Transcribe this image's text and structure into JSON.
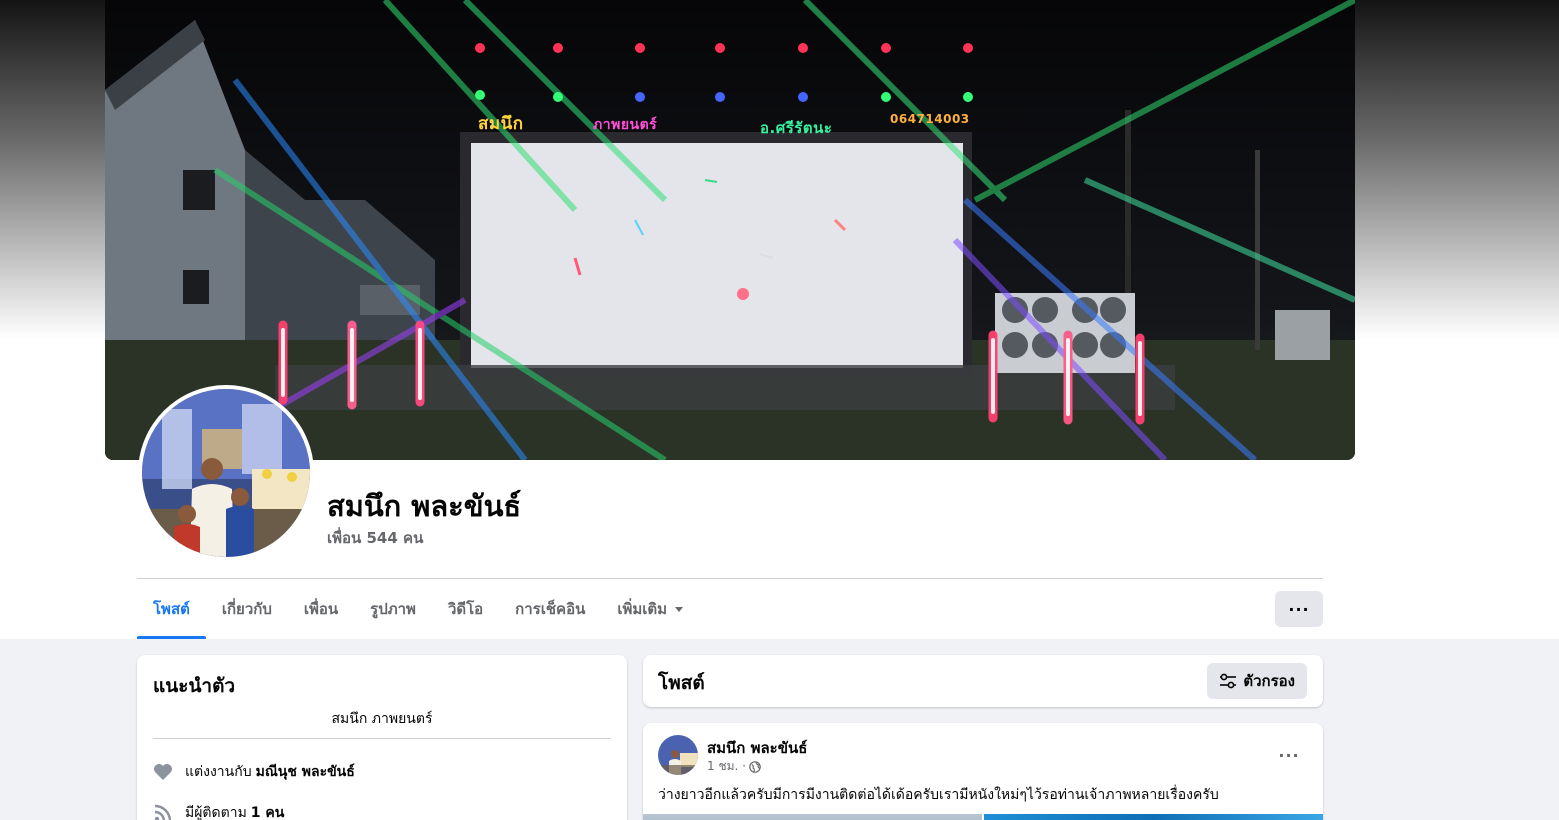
{
  "profile": {
    "name": "สมนึก พละขันธ์",
    "friends_text": "เพื่อน 544 คน",
    "cover_photo": {
      "sign_words": [
        "สมนึก",
        "ภาพยนตร์",
        "อ.ศรีรัตนะ",
        "064714003"
      ]
    }
  },
  "nav": {
    "tabs": [
      {
        "label": "โพสต์",
        "active": true
      },
      {
        "label": "เกี่ยวกับ",
        "active": false
      },
      {
        "label": "เพื่อน",
        "active": false
      },
      {
        "label": "รูปภาพ",
        "active": false
      },
      {
        "label": "วิดีโอ",
        "active": false
      },
      {
        "label": "การเช็คอิน",
        "active": false
      },
      {
        "label": "เพิ่มเติม",
        "active": false
      }
    ],
    "more_button_label": "···"
  },
  "intro": {
    "title": "แนะนำตัว",
    "bio": "สมนึก ภาพยนตร์",
    "married_prefix": "แต่งงานกับ",
    "married_name": "มณีนุช พละขันธ์",
    "followers_prefix": "มีผู้ติดตาม",
    "followers_count": "1 คน"
  },
  "posts_section": {
    "title": "โพสต์",
    "filter_label": "ตัวกรอง"
  },
  "post": {
    "author": "สมนึก พละขันธ์",
    "time": "1 ชม. ·",
    "more_label": "···",
    "text": "ว่างยาวอีกแล้วครับมีการมีงานติดต่อได้เด้อครับเรามีหนังใหม่ๆไว้รอท่านเจ้าภาพหลายเรื่องครับ"
  },
  "colors": {
    "accent": "#1877f2",
    "secondary_text": "#65676b",
    "page_bg": "#f0f2f5",
    "button_bg": "#e4e6eb"
  },
  "icons": {
    "married": "heart-icon",
    "followers": "rss-icon",
    "filter": "sliders-icon",
    "audience": "globe-icon",
    "tab_more": "caret-down-icon"
  }
}
